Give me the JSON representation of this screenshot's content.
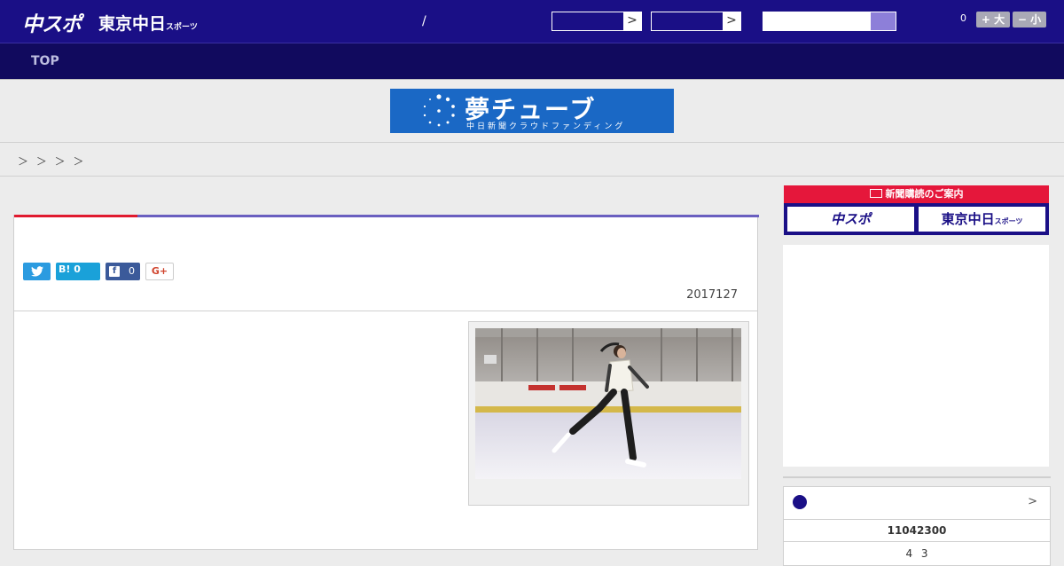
{
  "header": {
    "logo_chuspo": "中スポ",
    "logo_tokyo": "東京中日",
    "logo_tokyo_sub": "スポーツ",
    "slash": "/",
    "select1_arrow": ">",
    "select2_arrow": ">",
    "comment_count": "0",
    "font_big": "+ 大",
    "font_small": "− 小"
  },
  "nav": {
    "top_label": "TOP"
  },
  "banner": {
    "title": "夢チューブ",
    "subtitle": "中日新聞クラウドファンディング"
  },
  "breadcrumb": {
    "text": "＞ ＞  ＞ ＞"
  },
  "article": {
    "share": {
      "twitter": "",
      "hatena": "B! 0",
      "facebook_count": "0",
      "googleplus": "G+"
    },
    "date": "2017127",
    "photo": {
      "description": "figure skater on ice rink"
    }
  },
  "sidebar": {
    "subscribe_head": "新聞購読のご案内",
    "subscribe_btn1": "中スポ",
    "subscribe_btn2": "東京中日",
    "subscribe_btn2_sub": "スポーツ",
    "score": {
      "chevron": ">",
      "line1": "11042300",
      "line2": "4 3"
    }
  },
  "colors": {
    "header_bg": "#1a0f86",
    "nav_bg": "#110a5e",
    "accent_red": "#e01a2e",
    "banner_blue": "#1a68c5"
  }
}
